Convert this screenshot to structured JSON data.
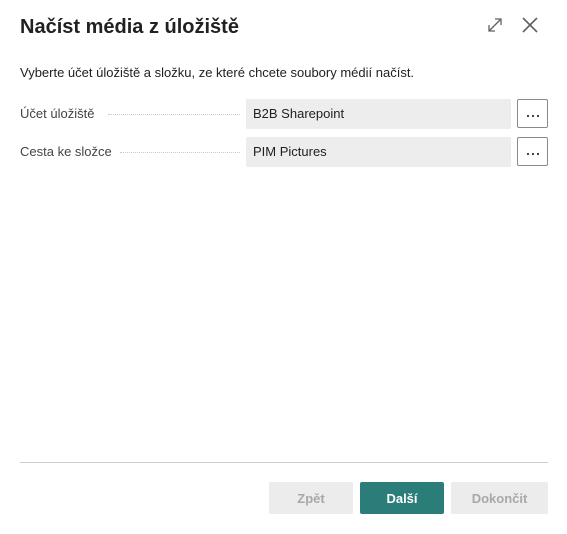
{
  "dialog": {
    "title": "Načíst média z úložiště",
    "instruction": "Vyberte účet úložiště a složku, ze které chcete soubory médií načíst.",
    "header_icons": {
      "expand": "expand-icon",
      "close": "close-icon"
    }
  },
  "fields": [
    {
      "label": "Účet úložiště",
      "value": "B2B Sharepoint",
      "lookup_label": "···"
    },
    {
      "label": "Cesta ke složce",
      "value": "PIM Pictures",
      "lookup_label": "···"
    }
  ],
  "footer": {
    "back_label": "Zpět",
    "next_label": "Další",
    "finish_label": "Dokončit"
  },
  "colors": {
    "accent": "#2b7d7a",
    "field_background": "#ededed",
    "disabled_button": "#ececec"
  }
}
